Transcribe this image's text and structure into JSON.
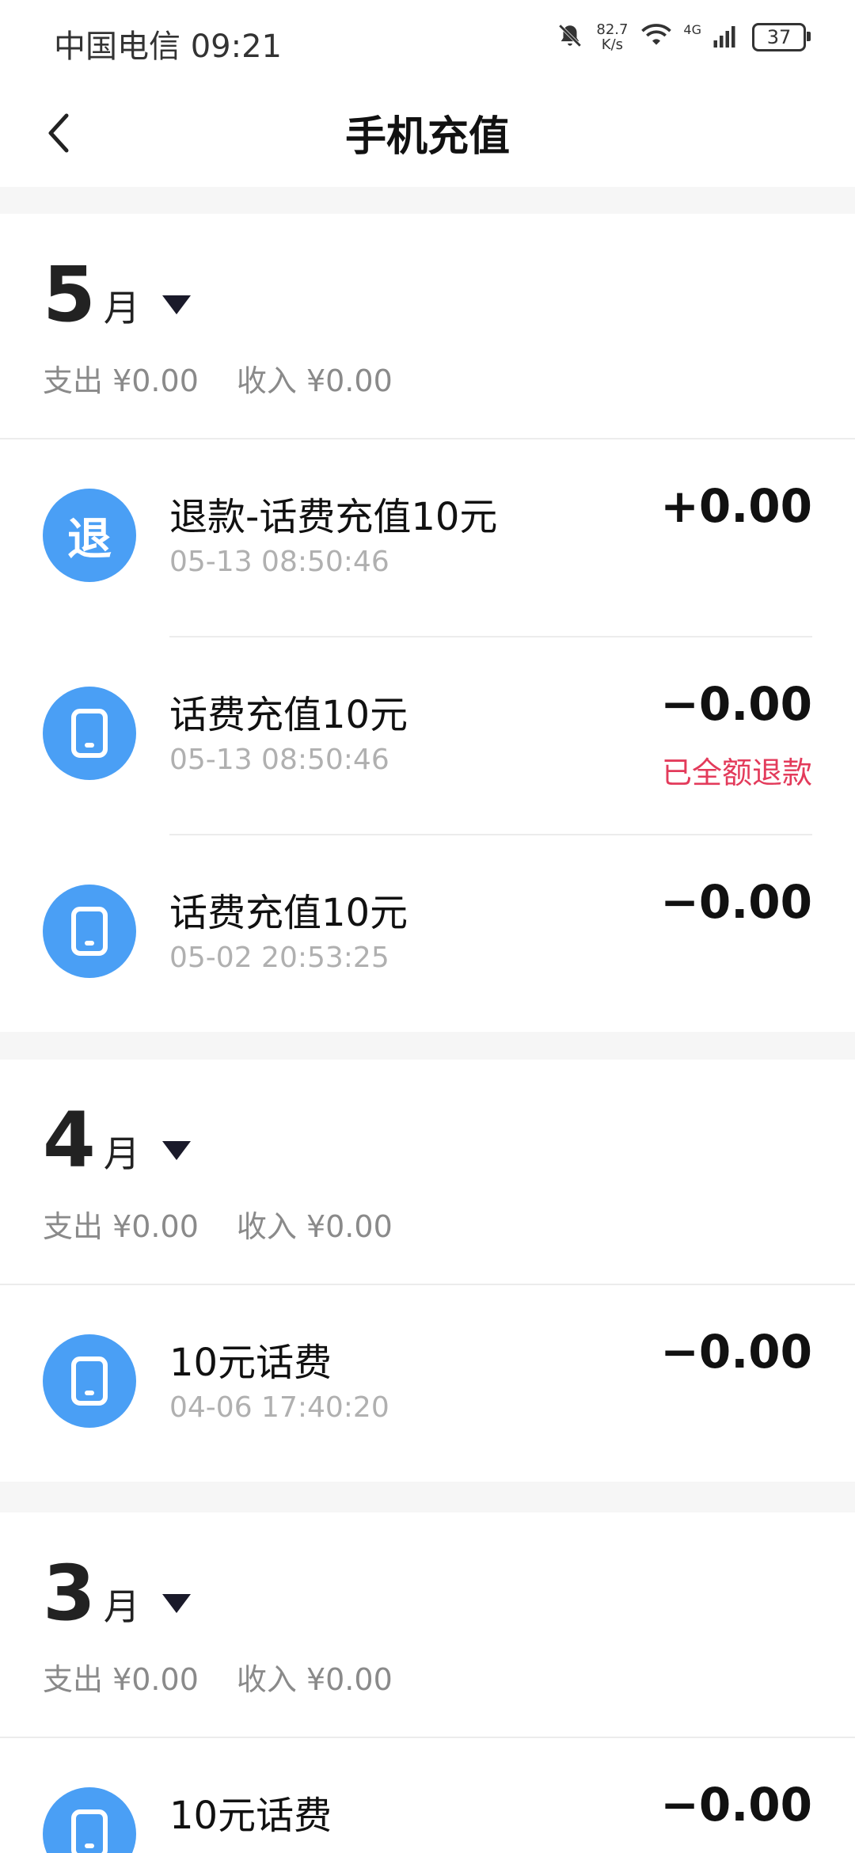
{
  "status_bar": {
    "carrier_time": "中国电信 09:21",
    "net_speed_value": "82.7",
    "net_speed_unit": "K/s",
    "network_type": "4G",
    "battery": "37"
  },
  "header": {
    "title": "手机充值"
  },
  "months": [
    {
      "month": "5",
      "suffix": "月",
      "expense": "支出 ¥0.00",
      "income": "收入 ¥0.00",
      "transactions": [
        {
          "icon": "refund-icon",
          "icon_text": "退",
          "title": "退款-话费充值10元",
          "time": "05-13 08:50:46",
          "amount": "+0.00",
          "note": ""
        },
        {
          "icon": "phone-icon",
          "title": "话费充值10元",
          "time": "05-13 08:50:46",
          "amount": "−0.00",
          "note": "已全额退款"
        },
        {
          "icon": "phone-icon",
          "title": "话费充值10元",
          "time": "05-02 20:53:25",
          "amount": "−0.00",
          "note": ""
        }
      ]
    },
    {
      "month": "4",
      "suffix": "月",
      "expense": "支出 ¥0.00",
      "income": "收入 ¥0.00",
      "transactions": [
        {
          "icon": "phone-icon",
          "title": "10元话费",
          "time": "04-06 17:40:20",
          "amount": "−0.00",
          "note": ""
        }
      ]
    },
    {
      "month": "3",
      "suffix": "月",
      "expense": "支出 ¥0.00",
      "income": "收入 ¥0.00",
      "transactions": [
        {
          "icon": "phone-icon",
          "title": "10元话费",
          "time": "",
          "amount": "−0.00",
          "note": ""
        }
      ]
    }
  ],
  "colors": {
    "icon_bg": "#4a9ff5",
    "refund_note": "#e33b5b",
    "page_bg": "#f6f6f6"
  }
}
